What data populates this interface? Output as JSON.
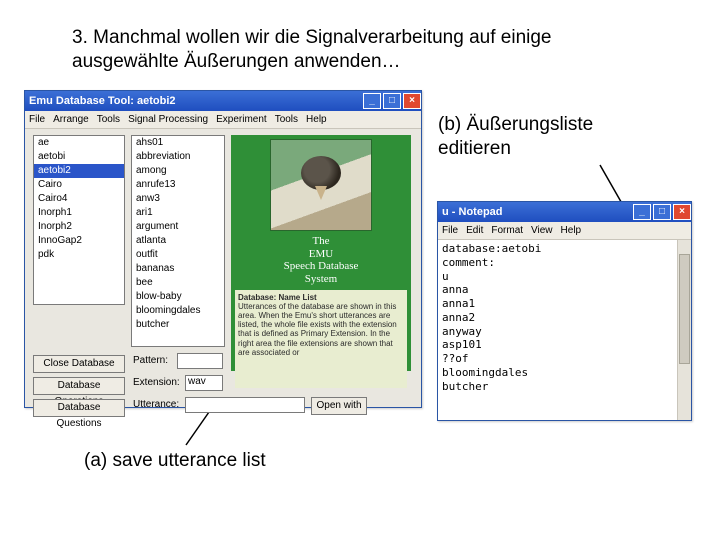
{
  "slide": {
    "title": "3. Manchmal wollen wir die Signalverarbeitung auf einige ausgewählte Äußerungen anwenden…",
    "caption_a": "(a) save utterance list",
    "caption_b": "(b) Äußerungsliste editieren"
  },
  "emu": {
    "title": "Emu Database Tool: aetobi2",
    "menubar": [
      "File",
      "Arrange",
      "Tools",
      "Signal Processing",
      "Experiment",
      "Tools",
      "Help"
    ],
    "col1": [
      "ae",
      "aetobi",
      "aetobi2",
      "Cairo",
      "Cairo4",
      "Inorph1",
      "Inorph2",
      "InnoGap2",
      "pdk"
    ],
    "col1_selected": 2,
    "col2": [
      "ahs01",
      "abbreviation",
      "among",
      "anrufe13",
      "anw3",
      "ari1",
      "argument",
      "atlanta",
      "outfit",
      "bananas",
      "bee",
      "blow-baby",
      "bloomingdales",
      "butcher"
    ],
    "btn_close": "Close Database",
    "btn_db_ops": "Database Operations",
    "btn_db_q": "Database Questions",
    "lbl_pattern": "Pattern:",
    "lbl_extension": "Extension:",
    "ext_value": "wav",
    "lbl_utterance": "Utterance:",
    "btn_open": "Open with",
    "img_caption": "The\nEMU\nSpeech Database\nSystem",
    "desc_title": "Database: Name List",
    "desc_body": "Utterances of the database are shown in this area. When the Emu's short utterances are listed, the whole file exists with the extension that is defined as Primary Extension. In the right area the file extensions are shown that are associated or"
  },
  "notepad": {
    "title": "u - Notepad",
    "menubar": [
      "File",
      "Edit",
      "Format",
      "View",
      "Help"
    ],
    "content": "database:aetobi\\ncomment:\\nu\\nanna\\nanna1\\nanna2\\nanyway\\nasp101\\n??of\\nbloomingdales\\nbutcher"
  }
}
